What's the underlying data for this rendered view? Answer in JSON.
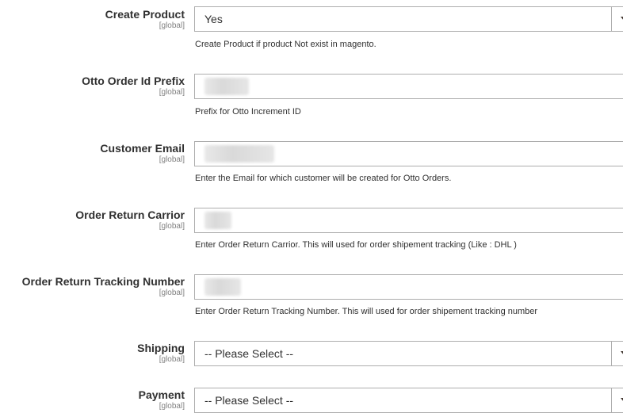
{
  "fields": {
    "create_product": {
      "label": "Create Product",
      "scope": "[global]",
      "value": "Yes",
      "note": "Create Product if product Not exist in magento."
    },
    "order_prefix": {
      "label": "Otto Order Id Prefix",
      "scope": "[global]",
      "note": "Prefix for Otto Increment ID"
    },
    "customer_email": {
      "label": "Customer Email",
      "scope": "[global]",
      "note": "Enter the Email for which customer will be created for Otto Orders."
    },
    "return_carrier": {
      "label": "Order Return Carrior",
      "scope": "[global]",
      "note": "Enter Order Return Carrior. This will used for order shipement tracking (Like : DHL )"
    },
    "return_tracking": {
      "label": "Order Return Tracking Number",
      "scope": "[global]",
      "note": "Enter Order Return Tracking Number. This will used for order shipement tracking number"
    },
    "shipping": {
      "label": "Shipping",
      "scope": "[global]",
      "value": "-- Please Select --"
    },
    "payment": {
      "label": "Payment",
      "scope": "[global]",
      "value": "-- Please Select --"
    }
  },
  "icons": {
    "dropdown": "triangle-down-icon"
  },
  "colors": {
    "border": "#adadad",
    "text": "#303030",
    "scope": "#808080"
  }
}
